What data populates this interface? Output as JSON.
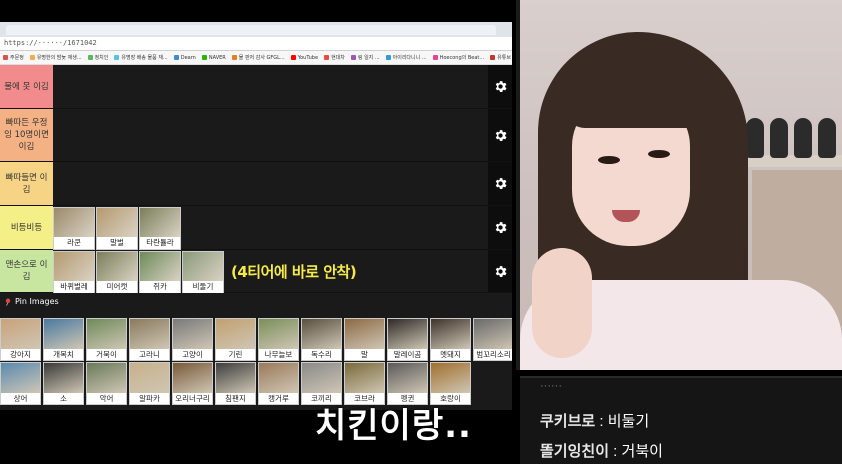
{
  "browser": {
    "url": "https://······/1671042",
    "bookmarks": [
      "주문정",
      "유명한의 밤늦 재생...",
      "정치인",
      "유명장 배송 물품 재...",
      "Dearn",
      "NAVER",
      "물 판저 감사 GFGL...",
      "YouTube",
      "현대차",
      "링 일지 ...",
      "아이리다니니 ...",
      "Hoecong의 Beat...",
      "유튜브",
      "출장 작 목록"
    ]
  },
  "tiers": [
    {
      "label": "물에 못 이김",
      "color": "#f28c8c"
    },
    {
      "label": "빠따든 우정잉 10명이면 이김",
      "color": "#f4b183"
    },
    {
      "label": "빠따들면 이김",
      "color": "#f7d485"
    },
    {
      "label": "비등비등",
      "color": "#f5ef88",
      "items": [
        "라쿤",
        "말벌",
        "타란튤라"
      ]
    },
    {
      "label": "맨손으로 이김",
      "color": "#c8e6a0",
      "items": [
        "바퀴벌레",
        "미어캣",
        "쥐카",
        "비둘기"
      ]
    }
  ],
  "overlay_note": "(4티어에 바로 안착)",
  "pin": {
    "title": "Pin Images",
    "row1": [
      "강아지",
      "개복치",
      "거북이",
      "고라니",
      "고양이",
      "기린",
      "나무늘보",
      "독수리",
      "말",
      "말레이곰",
      "멧돼지",
      "범꼬리소리"
    ],
    "row2": [
      "상어",
      "소",
      "악어",
      "알파카",
      "오리너구리",
      "침팬지",
      "캥거루",
      "코끼리",
      "코브라",
      "펭귄",
      "호랑이"
    ]
  },
  "chat": {
    "lines": [
      {
        "user": "쿠키브로",
        "message": "비둘기"
      },
      {
        "user": "똘기잉친이",
        "message": "거북이"
      }
    ]
  },
  "subtitle": "치킨이랑..",
  "colors": {
    "overlay_note": "#f5ea4a",
    "gear_bg": "#0d0d0d",
    "panel_bg": "#1a1a1a"
  }
}
